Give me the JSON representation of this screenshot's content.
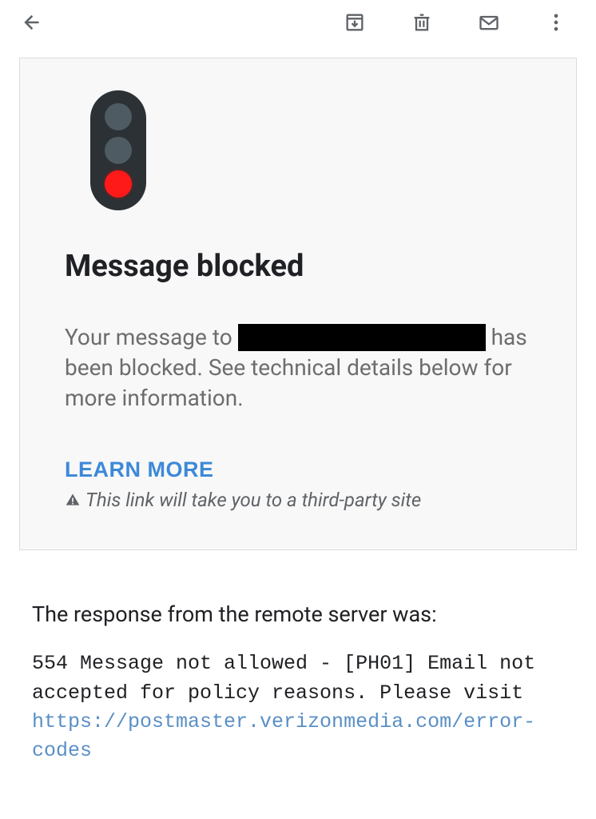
{
  "card": {
    "title": "Message blocked",
    "body_prefix": "Your message to ",
    "body_suffix": " has been blocked. See technical details below for more information.",
    "learn_more_label": "LEARN MORE",
    "warning_text": "This link will take you to a third-party site"
  },
  "response": {
    "heading": "The response from the remote server was:",
    "code_prefix": "554 Message not allowed - [PH01] Email not accepted for policy reasons. Please visit ",
    "link_text": "https://postmaster.verizonmedia.com/error-codes"
  }
}
